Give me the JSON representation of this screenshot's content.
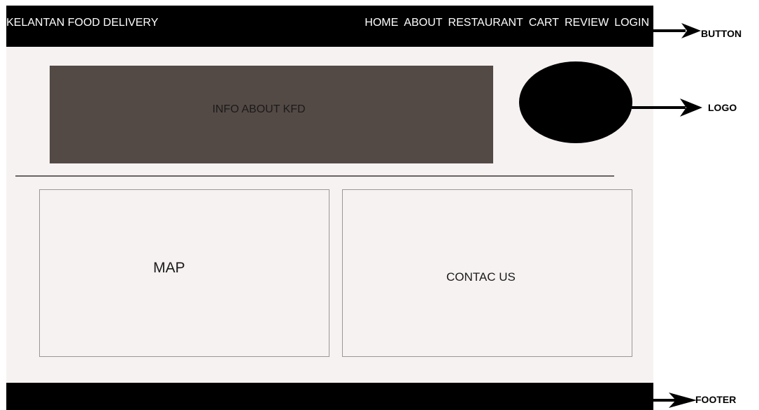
{
  "header": {
    "brand": "KELANTAN FOOD DELIVERY",
    "nav_items": [
      "HOME",
      "ABOUT",
      "RESTAURANT",
      "CART",
      "REVIEW",
      "LOGIN"
    ]
  },
  "hero": {
    "info_text": "INFO ABOUT KFD"
  },
  "sections": {
    "map_label": "MAP",
    "contact_label": "CONTAC US"
  },
  "annotations": {
    "button": "BUTTON",
    "logo": "LOGO",
    "footer": "FOOTER"
  },
  "colors": {
    "navbar": "#000000",
    "page_bg": "#f7f2f2",
    "info_box": "#544a45",
    "logo": "#000000",
    "footer": "#000000"
  }
}
